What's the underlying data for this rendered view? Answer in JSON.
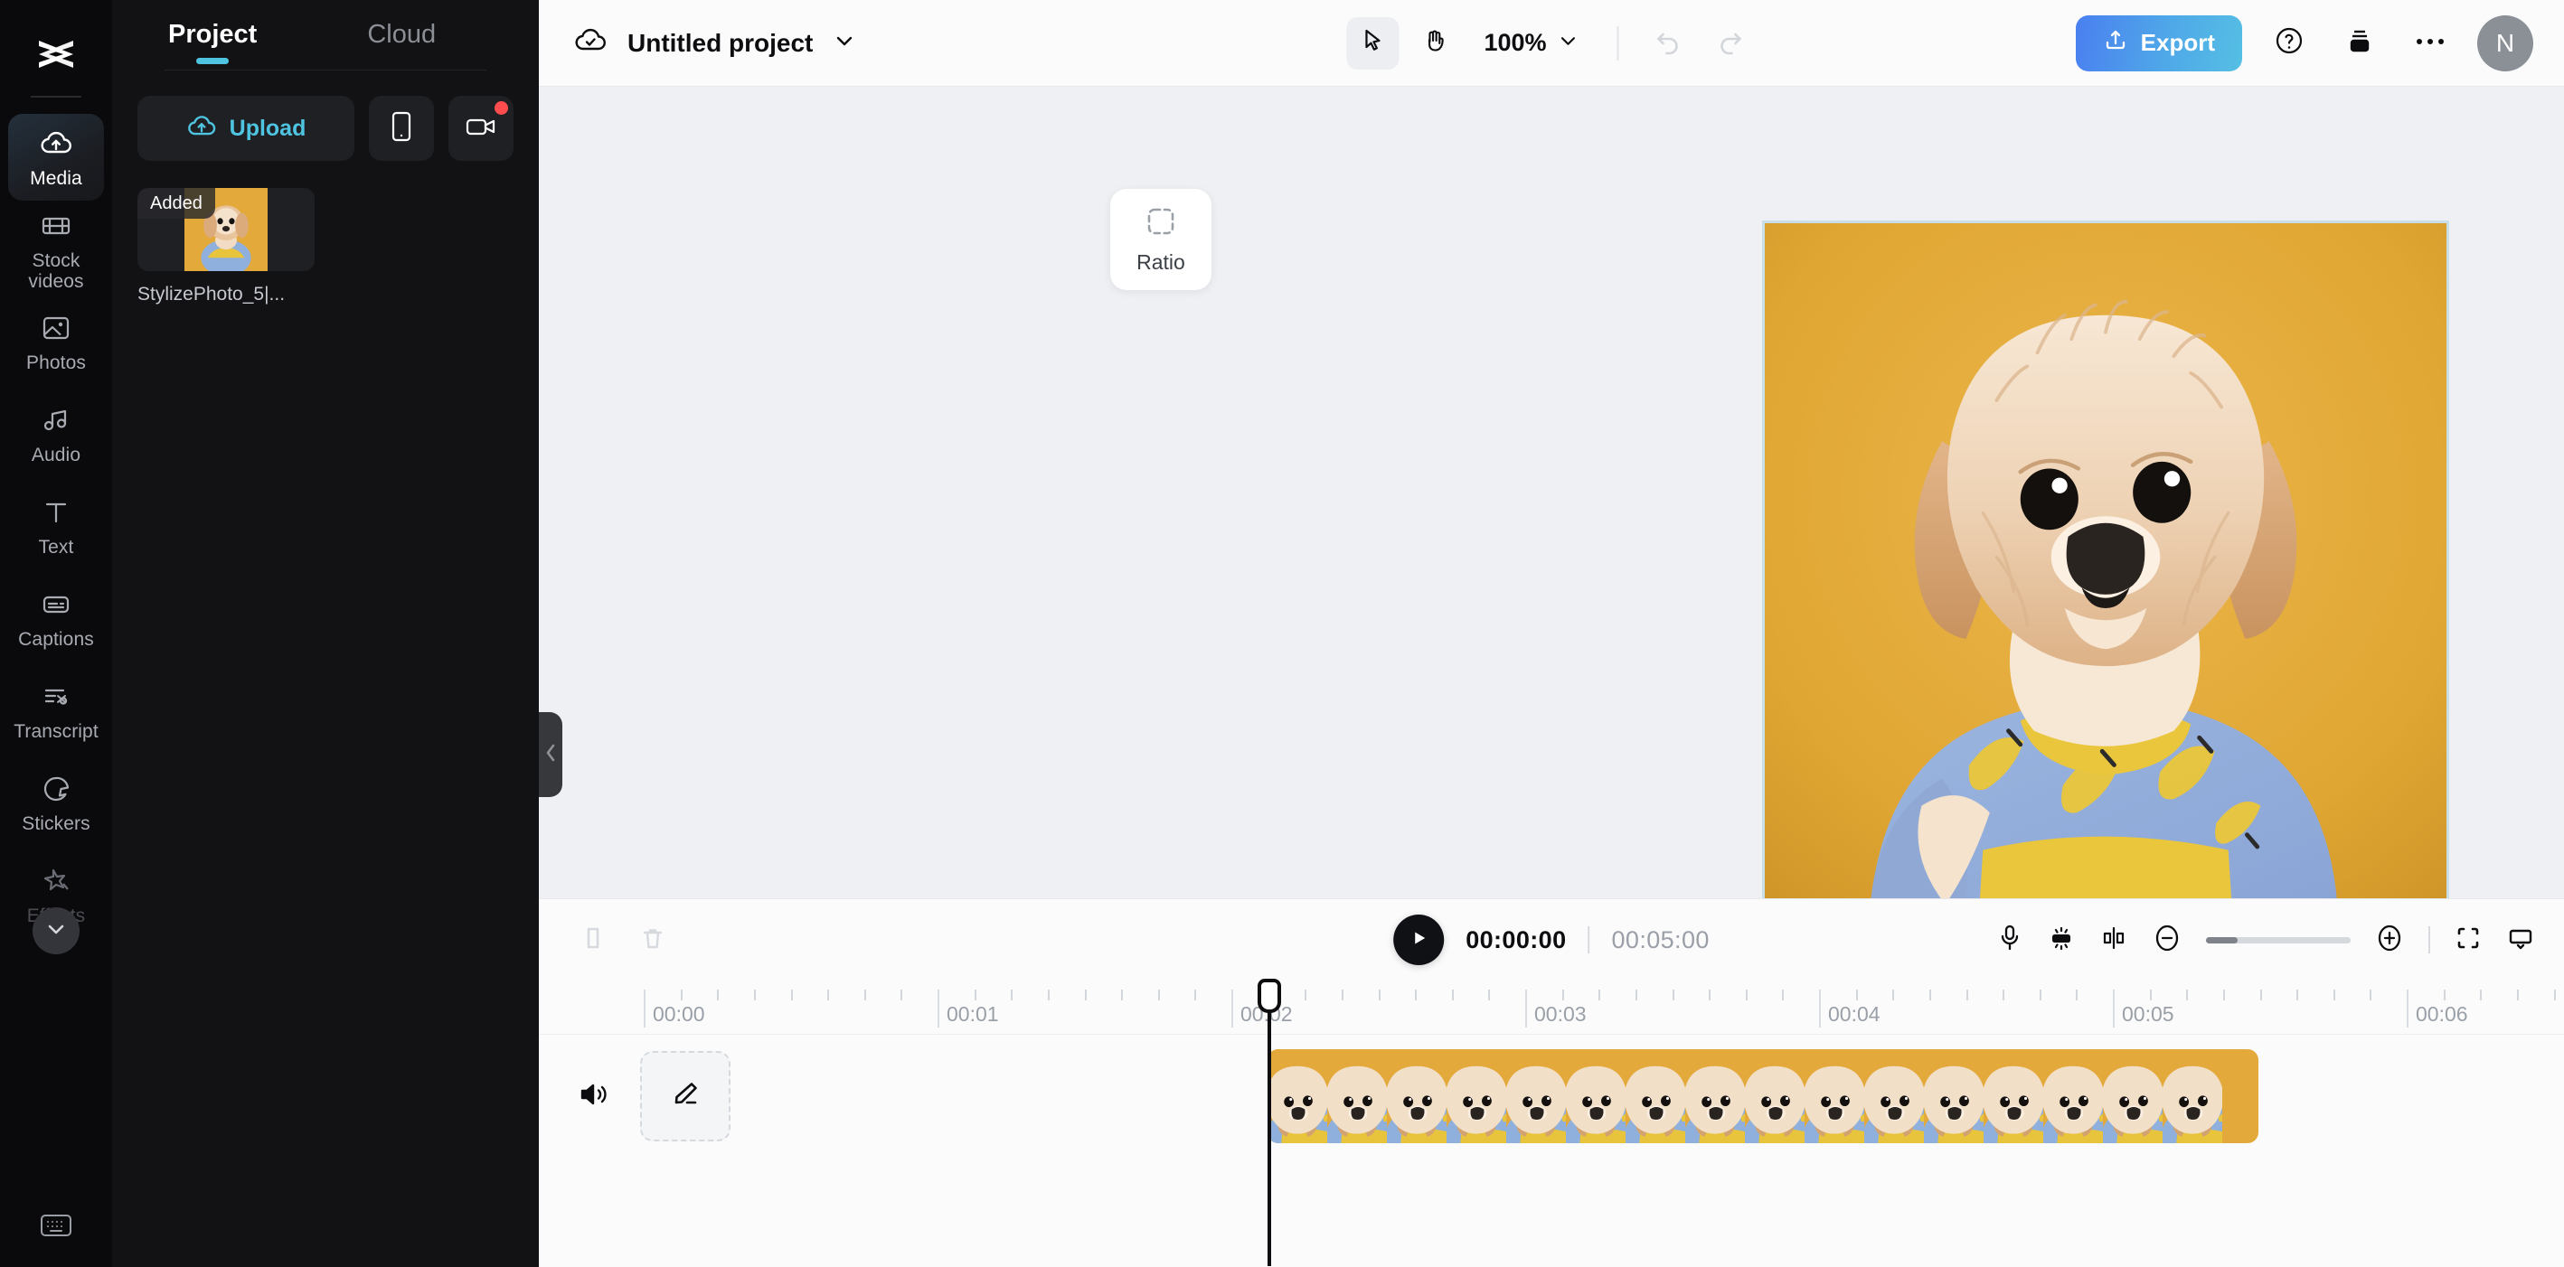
{
  "app": {
    "name": "CapCut",
    "logo_icon": "capcut-logo-icon"
  },
  "rail": {
    "items": [
      {
        "id": "media",
        "label": "Media",
        "icon": "cloud-upload-icon",
        "active": true,
        "dim": false
      },
      {
        "id": "stock-videos",
        "label": "Stock\nvideos",
        "icon": "film-icon",
        "active": false,
        "dim": false
      },
      {
        "id": "photos",
        "label": "Photos",
        "icon": "image-icon",
        "active": false,
        "dim": false
      },
      {
        "id": "audio",
        "label": "Audio",
        "icon": "music-note-icon",
        "active": false,
        "dim": false
      },
      {
        "id": "text",
        "label": "Text",
        "icon": "text-t-icon",
        "active": false,
        "dim": false
      },
      {
        "id": "captions",
        "label": "Captions",
        "icon": "captions-icon",
        "active": false,
        "dim": false
      },
      {
        "id": "transcript",
        "label": "Transcript",
        "icon": "transcript-icon",
        "active": false,
        "dim": false
      },
      {
        "id": "stickers",
        "label": "Stickers",
        "icon": "sticker-icon",
        "active": false,
        "dim": false
      },
      {
        "id": "effects",
        "label": "Effects",
        "icon": "sparkle-star-icon",
        "active": false,
        "dim": true
      }
    ],
    "expand_icon": "chevron-down-icon",
    "keyboard_icon": "keyboard-icon"
  },
  "panel": {
    "tabs": [
      {
        "id": "project",
        "label": "Project",
        "active": true
      },
      {
        "id": "cloud",
        "label": "Cloud",
        "active": false
      }
    ],
    "actions": {
      "upload_label": "Upload",
      "upload_icon": "cloud-upload-icon",
      "phone_icon": "phone-icon",
      "record_icon": "video-camera-icon",
      "record_has_badge": true
    },
    "media": [
      {
        "name": "StylizePhoto_5|...",
        "badge": "Added"
      }
    ]
  },
  "topbar": {
    "cloud_icon": "cloud-check-icon",
    "project_title": "Untitled project",
    "title_chevron_icon": "chevron-down-icon",
    "tools": [
      {
        "id": "select",
        "icon": "cursor-arrow-icon",
        "selected": true
      },
      {
        "id": "hand",
        "icon": "hand-icon",
        "selected": false
      }
    ],
    "zoom_level": "100%",
    "zoom_chevron_icon": "chevron-down-icon",
    "undo_icon": "undo-icon",
    "redo_icon": "redo-icon",
    "export_label": "Export",
    "export_icon": "share-up-icon",
    "help_icon": "question-circle-icon",
    "layers_icon": "stack-icon",
    "more_icon": "ellipsis-icon",
    "avatar_initial": "N",
    "export_color": "#4fa3e8"
  },
  "stage": {
    "ratio_label": "Ratio",
    "ratio_icon": "crop-frame-icon",
    "collapse_icon": "chevron-left-icon",
    "preview_alt": "stylized-dog-portrait"
  },
  "timeline": {
    "split_icon": "split-clip-icon",
    "delete_icon": "trash-icon",
    "play_icon": "play-icon",
    "current_time": "00:00:00",
    "total_duration": "00:05:00",
    "time_separator": "|",
    "right_tools": [
      {
        "id": "voiceover",
        "icon": "microphone-icon"
      },
      {
        "id": "auto-adjust",
        "icon": "magic-adjust-icon"
      },
      {
        "id": "transition",
        "icon": "transition-icon"
      }
    ],
    "zoom_out_icon": "minus-circle-icon",
    "zoom_in_icon": "plus-circle-icon",
    "zoom_fill_percent": 22,
    "fit_icon": "fit-screen-icon",
    "panel_icon": "panel-toggle-icon",
    "ruler_labels": [
      "00:00",
      "00:01",
      "00:02",
      "00:03",
      "00:04",
      "00:05",
      "00:06"
    ],
    "track": {
      "volume_icon": "speaker-icon",
      "edit_icon": "pencil-icon",
      "clip_frames": 16
    }
  }
}
